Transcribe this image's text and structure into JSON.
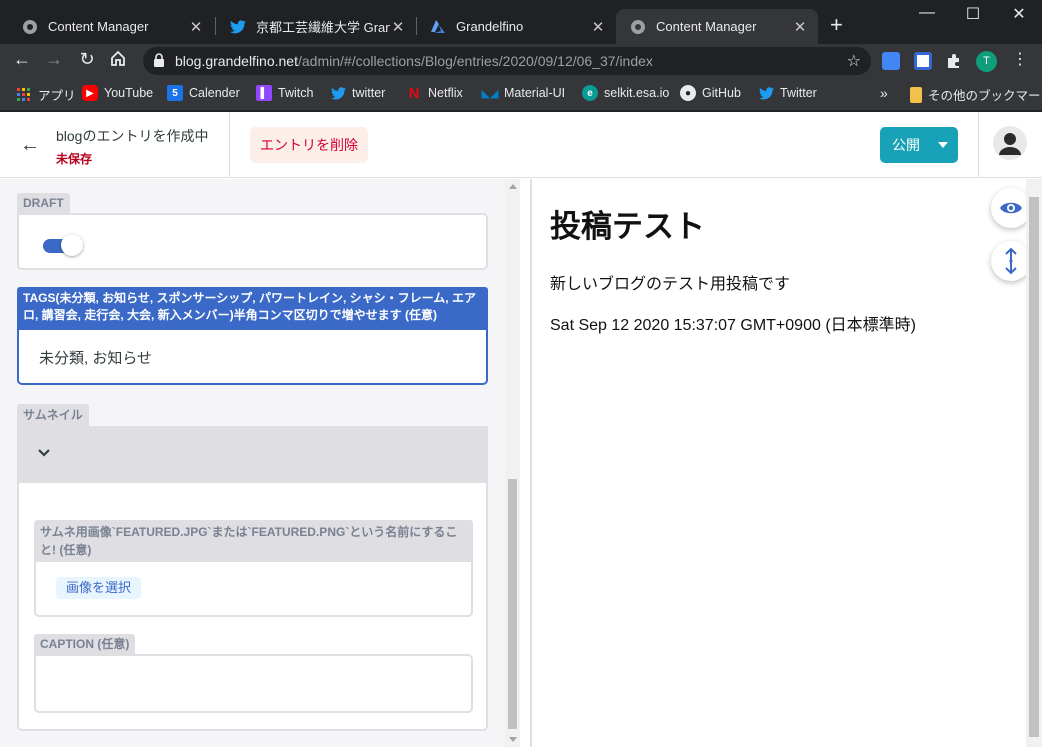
{
  "browser": {
    "tabs": [
      {
        "title": "Content Manager",
        "icon": "globe-icon"
      },
      {
        "title": "京都工芸繊維大学 Grande",
        "icon": "twitter-icon"
      },
      {
        "title": "Grandelfino",
        "icon": "azure-icon"
      },
      {
        "title": "Content Manager",
        "icon": "globe-icon",
        "active": true
      }
    ],
    "url_host": "blog.grandelfino.net",
    "url_path": "/admin/#/collections/Blog/entries/2020/09/12/06_37/index",
    "profile_initial": "T",
    "bookmarks": [
      {
        "label": "アプリ",
        "icon": "apps-grid-icon"
      },
      {
        "label": "YouTube",
        "icon": "youtube-icon"
      },
      {
        "label": "Calender",
        "icon": "calendar-icon",
        "icon_text": "5"
      },
      {
        "label": "Twitch",
        "icon": "twitch-icon"
      },
      {
        "label": "twitter",
        "icon": "twitter-icon"
      },
      {
        "label": "Netflix",
        "icon": "netflix-icon"
      },
      {
        "label": "Material-UI",
        "icon": "material-ui-icon"
      },
      {
        "label": "selkit.esa.io",
        "icon": "esa-icon"
      },
      {
        "label": "GitHub",
        "icon": "github-icon"
      },
      {
        "label": "Twitter",
        "icon": "twitter-icon"
      }
    ],
    "other_bookmarks": "その他のブックマーク"
  },
  "header": {
    "back_icon": "arrow-left-icon",
    "entry_title": "blogのエントリを作成中",
    "entry_status": "未保存",
    "delete_label": "エントリを削除",
    "publish_label": "公開"
  },
  "editor": {
    "draft_label": "DRAFT",
    "draft_value": true,
    "tags_label": "TAGS(未分類, お知らせ, スポンサーシップ, パワートレイン, シャシ・フレーム, エアロ, 講習会, 走行会, 大会, 新入メンバー)半角コンマ区切りで増やせます (任意)",
    "tags_value": "未分類, お知らせ",
    "thumbnail_label": "サムネイル",
    "image_label": "サムネ用画像`FEATURED.JPG`または`FEATURED.PNG`という名前にすること! (任意)",
    "choose_image_label": "画像を選択",
    "caption_label": "CAPTION (任意)",
    "caption_value": ""
  },
  "preview": {
    "title": "投稿テスト",
    "body": "新しいブログのテスト用投稿です",
    "date": "Sat Sep 12 2020 15:37:07 GMT+0900 (日本標準時)"
  },
  "colors": {
    "accent": "#3a69c7",
    "publish": "#17a2b8",
    "danger": "#d60032"
  }
}
